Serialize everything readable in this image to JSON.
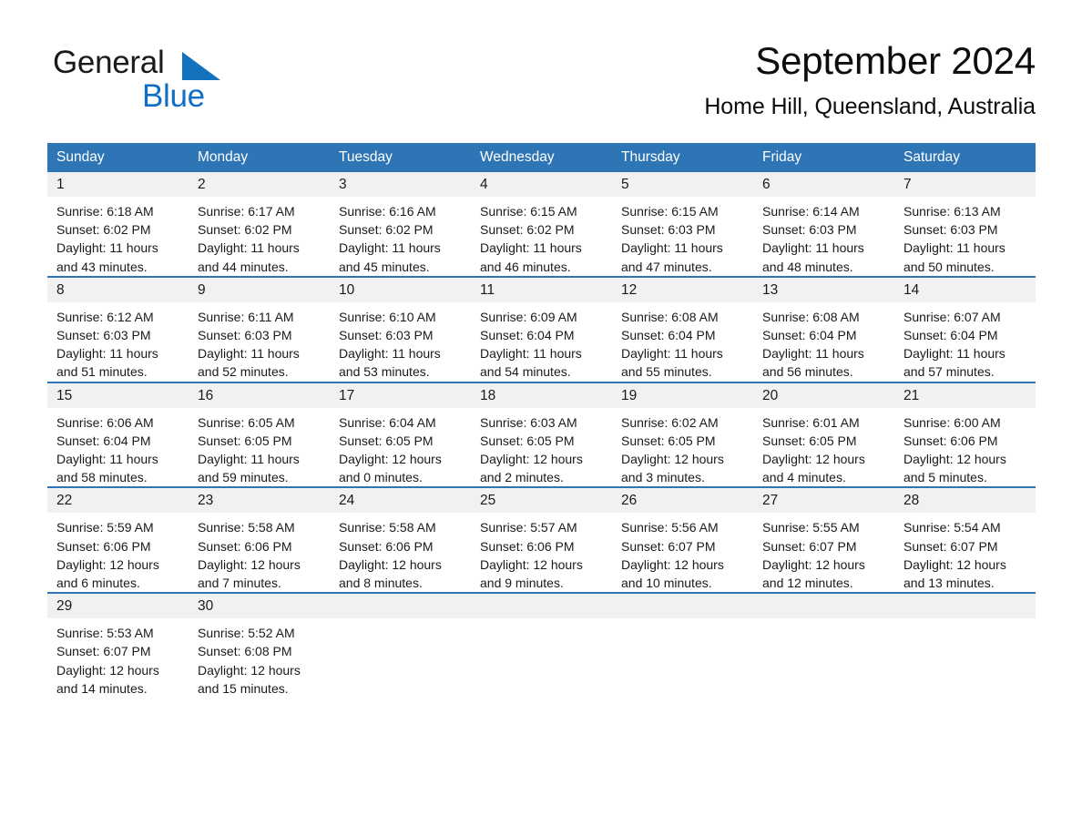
{
  "brand": {
    "name_part1": "General",
    "name_part2": "Blue",
    "triangle_icon": "triangle-icon",
    "accent_color": "#0f6fc6"
  },
  "header": {
    "title": "September 2024",
    "subtitle": "Home Hill, Queensland, Australia"
  },
  "theme": {
    "header_blue": "#2e75b6",
    "day_band_gray": "#f1f1f1",
    "text_color": "#1a1a1a"
  },
  "calendar": {
    "weekdays": [
      "Sunday",
      "Monday",
      "Tuesday",
      "Wednesday",
      "Thursday",
      "Friday",
      "Saturday"
    ],
    "weeks": [
      [
        {
          "day": "1",
          "sunrise": "Sunrise: 6:18 AM",
          "sunset": "Sunset: 6:02 PM",
          "daylight_line1": "Daylight: 11 hours",
          "daylight_line2": "and 43 minutes."
        },
        {
          "day": "2",
          "sunrise": "Sunrise: 6:17 AM",
          "sunset": "Sunset: 6:02 PM",
          "daylight_line1": "Daylight: 11 hours",
          "daylight_line2": "and 44 minutes."
        },
        {
          "day": "3",
          "sunrise": "Sunrise: 6:16 AM",
          "sunset": "Sunset: 6:02 PM",
          "daylight_line1": "Daylight: 11 hours",
          "daylight_line2": "and 45 minutes."
        },
        {
          "day": "4",
          "sunrise": "Sunrise: 6:15 AM",
          "sunset": "Sunset: 6:02 PM",
          "daylight_line1": "Daylight: 11 hours",
          "daylight_line2": "and 46 minutes."
        },
        {
          "day": "5",
          "sunrise": "Sunrise: 6:15 AM",
          "sunset": "Sunset: 6:03 PM",
          "daylight_line1": "Daylight: 11 hours",
          "daylight_line2": "and 47 minutes."
        },
        {
          "day": "6",
          "sunrise": "Sunrise: 6:14 AM",
          "sunset": "Sunset: 6:03 PM",
          "daylight_line1": "Daylight: 11 hours",
          "daylight_line2": "and 48 minutes."
        },
        {
          "day": "7",
          "sunrise": "Sunrise: 6:13 AM",
          "sunset": "Sunset: 6:03 PM",
          "daylight_line1": "Daylight: 11 hours",
          "daylight_line2": "and 50 minutes."
        }
      ],
      [
        {
          "day": "8",
          "sunrise": "Sunrise: 6:12 AM",
          "sunset": "Sunset: 6:03 PM",
          "daylight_line1": "Daylight: 11 hours",
          "daylight_line2": "and 51 minutes."
        },
        {
          "day": "9",
          "sunrise": "Sunrise: 6:11 AM",
          "sunset": "Sunset: 6:03 PM",
          "daylight_line1": "Daylight: 11 hours",
          "daylight_line2": "and 52 minutes."
        },
        {
          "day": "10",
          "sunrise": "Sunrise: 6:10 AM",
          "sunset": "Sunset: 6:03 PM",
          "daylight_line1": "Daylight: 11 hours",
          "daylight_line2": "and 53 minutes."
        },
        {
          "day": "11",
          "sunrise": "Sunrise: 6:09 AM",
          "sunset": "Sunset: 6:04 PM",
          "daylight_line1": "Daylight: 11 hours",
          "daylight_line2": "and 54 minutes."
        },
        {
          "day": "12",
          "sunrise": "Sunrise: 6:08 AM",
          "sunset": "Sunset: 6:04 PM",
          "daylight_line1": "Daylight: 11 hours",
          "daylight_line2": "and 55 minutes."
        },
        {
          "day": "13",
          "sunrise": "Sunrise: 6:08 AM",
          "sunset": "Sunset: 6:04 PM",
          "daylight_line1": "Daylight: 11 hours",
          "daylight_line2": "and 56 minutes."
        },
        {
          "day": "14",
          "sunrise": "Sunrise: 6:07 AM",
          "sunset": "Sunset: 6:04 PM",
          "daylight_line1": "Daylight: 11 hours",
          "daylight_line2": "and 57 minutes."
        }
      ],
      [
        {
          "day": "15",
          "sunrise": "Sunrise: 6:06 AM",
          "sunset": "Sunset: 6:04 PM",
          "daylight_line1": "Daylight: 11 hours",
          "daylight_line2": "and 58 minutes."
        },
        {
          "day": "16",
          "sunrise": "Sunrise: 6:05 AM",
          "sunset": "Sunset: 6:05 PM",
          "daylight_line1": "Daylight: 11 hours",
          "daylight_line2": "and 59 minutes."
        },
        {
          "day": "17",
          "sunrise": "Sunrise: 6:04 AM",
          "sunset": "Sunset: 6:05 PM",
          "daylight_line1": "Daylight: 12 hours",
          "daylight_line2": "and 0 minutes."
        },
        {
          "day": "18",
          "sunrise": "Sunrise: 6:03 AM",
          "sunset": "Sunset: 6:05 PM",
          "daylight_line1": "Daylight: 12 hours",
          "daylight_line2": "and 2 minutes."
        },
        {
          "day": "19",
          "sunrise": "Sunrise: 6:02 AM",
          "sunset": "Sunset: 6:05 PM",
          "daylight_line1": "Daylight: 12 hours",
          "daylight_line2": "and 3 minutes."
        },
        {
          "day": "20",
          "sunrise": "Sunrise: 6:01 AM",
          "sunset": "Sunset: 6:05 PM",
          "daylight_line1": "Daylight: 12 hours",
          "daylight_line2": "and 4 minutes."
        },
        {
          "day": "21",
          "sunrise": "Sunrise: 6:00 AM",
          "sunset": "Sunset: 6:06 PM",
          "daylight_line1": "Daylight: 12 hours",
          "daylight_line2": "and 5 minutes."
        }
      ],
      [
        {
          "day": "22",
          "sunrise": "Sunrise: 5:59 AM",
          "sunset": "Sunset: 6:06 PM",
          "daylight_line1": "Daylight: 12 hours",
          "daylight_line2": "and 6 minutes."
        },
        {
          "day": "23",
          "sunrise": "Sunrise: 5:58 AM",
          "sunset": "Sunset: 6:06 PM",
          "daylight_line1": "Daylight: 12 hours",
          "daylight_line2": "and 7 minutes."
        },
        {
          "day": "24",
          "sunrise": "Sunrise: 5:58 AM",
          "sunset": "Sunset: 6:06 PM",
          "daylight_line1": "Daylight: 12 hours",
          "daylight_line2": "and 8 minutes."
        },
        {
          "day": "25",
          "sunrise": "Sunrise: 5:57 AM",
          "sunset": "Sunset: 6:06 PM",
          "daylight_line1": "Daylight: 12 hours",
          "daylight_line2": "and 9 minutes."
        },
        {
          "day": "26",
          "sunrise": "Sunrise: 5:56 AM",
          "sunset": "Sunset: 6:07 PM",
          "daylight_line1": "Daylight: 12 hours",
          "daylight_line2": "and 10 minutes."
        },
        {
          "day": "27",
          "sunrise": "Sunrise: 5:55 AM",
          "sunset": "Sunset: 6:07 PM",
          "daylight_line1": "Daylight: 12 hours",
          "daylight_line2": "and 12 minutes."
        },
        {
          "day": "28",
          "sunrise": "Sunrise: 5:54 AM",
          "sunset": "Sunset: 6:07 PM",
          "daylight_line1": "Daylight: 12 hours",
          "daylight_line2": "and 13 minutes."
        }
      ],
      [
        {
          "day": "29",
          "sunrise": "Sunrise: 5:53 AM",
          "sunset": "Sunset: 6:07 PM",
          "daylight_line1": "Daylight: 12 hours",
          "daylight_line2": "and 14 minutes."
        },
        {
          "day": "30",
          "sunrise": "Sunrise: 5:52 AM",
          "sunset": "Sunset: 6:08 PM",
          "daylight_line1": "Daylight: 12 hours",
          "daylight_line2": "and 15 minutes."
        },
        {
          "day": "",
          "sunrise": "",
          "sunset": "",
          "daylight_line1": "",
          "daylight_line2": ""
        },
        {
          "day": "",
          "sunrise": "",
          "sunset": "",
          "daylight_line1": "",
          "daylight_line2": ""
        },
        {
          "day": "",
          "sunrise": "",
          "sunset": "",
          "daylight_line1": "",
          "daylight_line2": ""
        },
        {
          "day": "",
          "sunrise": "",
          "sunset": "",
          "daylight_line1": "",
          "daylight_line2": ""
        },
        {
          "day": "",
          "sunrise": "",
          "sunset": "",
          "daylight_line1": "",
          "daylight_line2": ""
        }
      ]
    ]
  }
}
